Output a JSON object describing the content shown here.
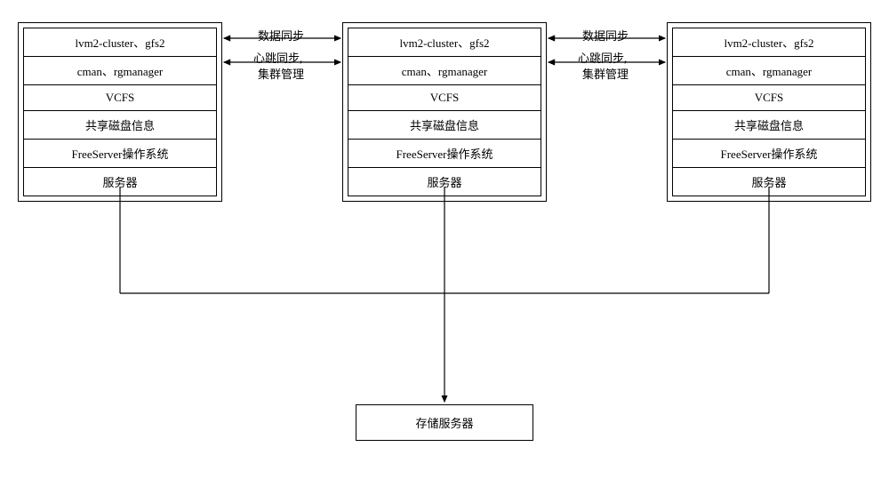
{
  "rows": {
    "r1": "lvm2-cluster、gfs2",
    "r2": "cman、rgmanager",
    "r3": "VCFS",
    "r4": "共享磁盘信息",
    "r5": "FreeServer操作系统",
    "r6": "服务器"
  },
  "labels": {
    "data_sync": "数据同步",
    "heartbeat_line1": "心跳同步,",
    "heartbeat_line2": "集群管理"
  },
  "storage": {
    "label": "存储服务器"
  }
}
